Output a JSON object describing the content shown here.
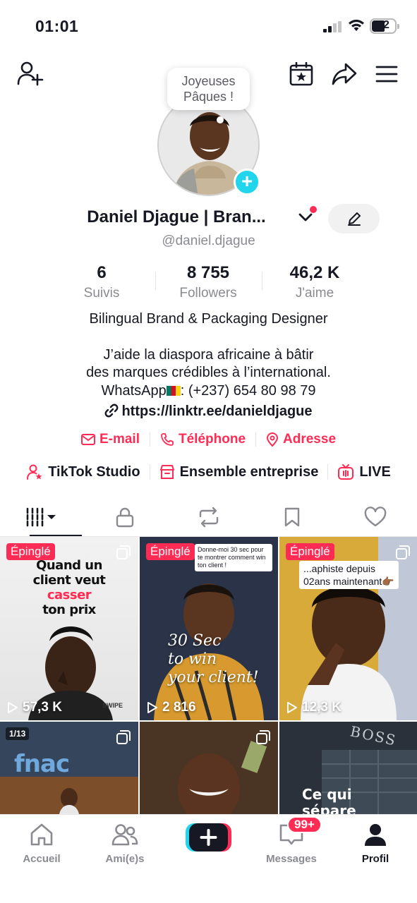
{
  "status_bar": {
    "time": "01:01",
    "battery": "52"
  },
  "profile": {
    "greeting_bubble_line1": "Joyeuses",
    "greeting_bubble_line2": "Pâques !",
    "display_name": "Daniel Djague | Bran...",
    "username": "@daniel.djague",
    "stats": [
      {
        "value": "6",
        "label": "Suivis"
      },
      {
        "value": "8 755",
        "label": "Followers"
      },
      {
        "value": "46,2 K",
        "label": "J'aime"
      }
    ],
    "bio": {
      "headline": "Bilingual Brand & Packaging Designer",
      "line1": "J’aide la diaspora africaine à bâtir",
      "line2": "des marques crédibles à l’international.",
      "line3_prefix": "WhatsApp",
      "line3_suffix": ": (+237) 654 80 98 79",
      "link": "https://linktr.ee/danieldjague"
    },
    "contacts": [
      "E-mail",
      "Téléphone",
      "Adresse"
    ],
    "tools": [
      "TikTok Studio",
      "Ensemble entreprise",
      "LIVE"
    ]
  },
  "videos": [
    {
      "pinned": "Épinglé",
      "title_lines": [
        "Quand un",
        "client veut",
        "casser",
        "ton prix"
      ],
      "caption": "SWIPE",
      "views": "57,3 K"
    },
    {
      "pinned": "Épinglé",
      "overlay_top": "Donne-moi 30 sec pour te montrer comment win ton client !",
      "title_lines": [
        "30 Sec",
        "to win",
        "your client!"
      ],
      "views": "2 816"
    },
    {
      "pinned": "Épinglé",
      "overlay_top_line1": "...aphiste depuis",
      "overlay_top_line2": "02ans maintenant👉🏾",
      "views": "12,3 K"
    },
    {
      "count": "1/13",
      "title": "fnac"
    },
    {
      "caption": ""
    },
    {
      "title_lines": [
        "Ce qui",
        "sépare"
      ],
      "sign": "BOSS"
    }
  ],
  "nav": {
    "items": [
      "Accueil",
      "Ami(e)s",
      "",
      "Messages",
      "Profil"
    ],
    "messages_badge": "99+"
  },
  "colors": {
    "accent": "#fe2c55",
    "cyan": "#20d5ec",
    "text": "#161823",
    "muted": "#8a8b91"
  }
}
